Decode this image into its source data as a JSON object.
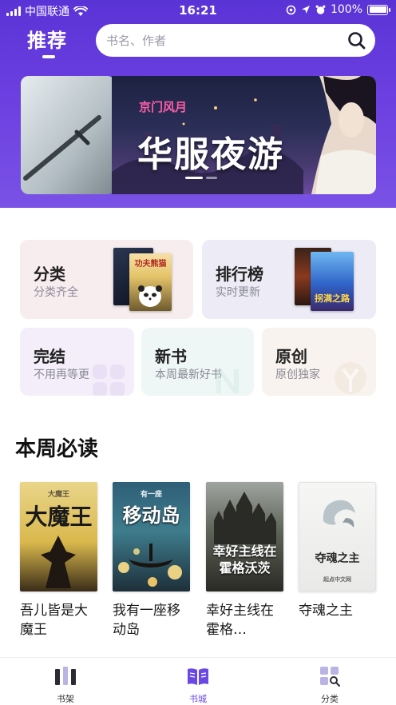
{
  "status_bar": {
    "carrier": "中国联通",
    "time": "16:21",
    "battery": "100%"
  },
  "header": {
    "tab_label": "推荐",
    "search_placeholder": "书名、作者"
  },
  "banner": {
    "brand": "京门风月",
    "title": "华服夜游"
  },
  "categories": [
    {
      "title": "分类",
      "subtitle": "分类齐全"
    },
    {
      "title": "排行榜",
      "subtitle": "实时更新"
    },
    {
      "title": "完结",
      "subtitle": "不用再等更"
    },
    {
      "title": "新书",
      "subtitle": "本周最新好书"
    },
    {
      "title": "原创",
      "subtitle": "原创独家"
    }
  ],
  "category_card_covers": {
    "fenlei": "功夫熊猫",
    "paihang": "拐满之路"
  },
  "weekly": {
    "title": "本周必读",
    "books": [
      {
        "name": "吾儿皆是大魔王",
        "cover_text": "大魔王",
        "cover_subtitle": "大魔王"
      },
      {
        "name": "我有一座移动岛",
        "cover_text": "移动岛",
        "cover_subtitle": "有一座"
      },
      {
        "name": "幸好主线在霍格…",
        "cover_text": "幸好主线在霍格沃茨"
      },
      {
        "name": "夺魂之主",
        "cover_text": "夺魂之主",
        "cover_subtitle": "起点中文网"
      }
    ]
  },
  "tabbar": {
    "items": [
      {
        "label": "书架",
        "icon": "bookshelf-icon"
      },
      {
        "label": "书城",
        "icon": "open-book-icon"
      },
      {
        "label": "分类",
        "icon": "category-grid-icon"
      }
    ],
    "active_index": 1,
    "active_color": "#6a48e6"
  },
  "colors": {
    "accent": "#6a48e6",
    "header_gradient_top": "#5a33d6"
  }
}
